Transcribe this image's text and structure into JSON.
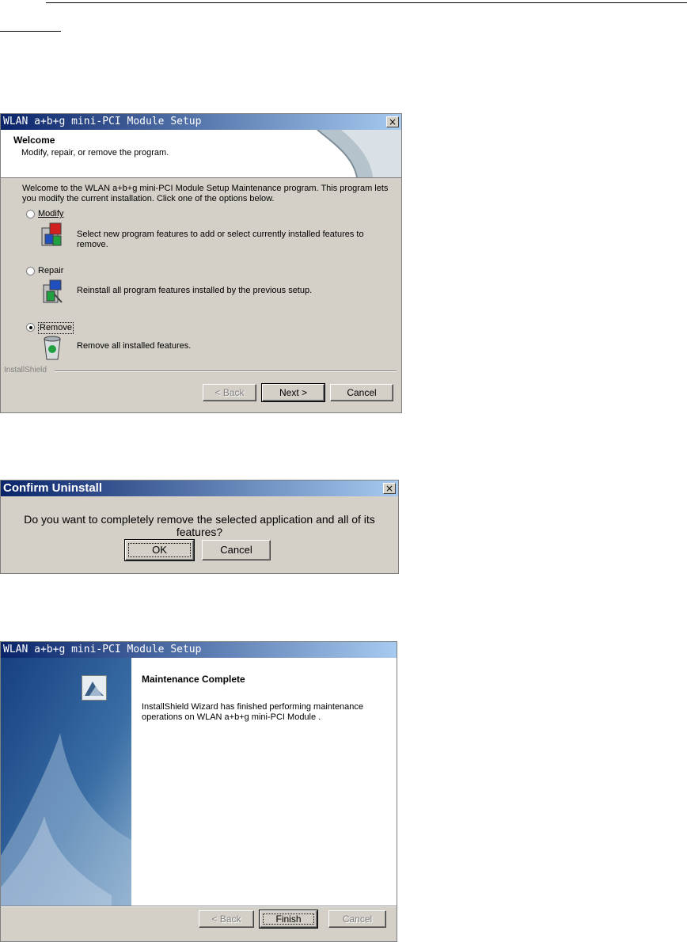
{
  "setup": {
    "title": "WLAN a+b+g mini-PCI Module Setup",
    "close": "×",
    "heading": "Welcome",
    "subheading": "Modify, repair, or remove the program.",
    "intro": "Welcome to the WLAN a+b+g mini-PCI Module Setup Maintenance program. This program lets you modify the current installation. Click one of the options below.",
    "options": [
      {
        "label": "Modify",
        "desc": "Select new program features to add or select currently installed features to remove.",
        "selected": false
      },
      {
        "label": "Repair",
        "desc": "Reinstall all program features installed by the previous setup.",
        "selected": false
      },
      {
        "label": "Remove",
        "desc": "Remove all installed features.",
        "selected": true
      }
    ],
    "brand": "InstallShield",
    "back": "< Back",
    "next": "Next >",
    "cancel": "Cancel"
  },
  "confirm": {
    "title": "Confirm Uninstall",
    "close": "×",
    "message": "Do you want to completely remove the selected application and all of its features?",
    "ok": "OK",
    "cancel": "Cancel"
  },
  "complete": {
    "title": "WLAN a+b+g mini-PCI Module Setup",
    "heading": "Maintenance Complete",
    "body": "InstallShield Wizard has finished performing maintenance operations on WLAN a+b+g mini-PCI Module .",
    "back": "< Back",
    "finish": "Finish",
    "cancel": "Cancel"
  },
  "colors": {
    "title_start": "#0a246a",
    "title_end": "#a6caf0",
    "face": "#d4d0c8",
    "sidebar": "#1f4f86"
  }
}
